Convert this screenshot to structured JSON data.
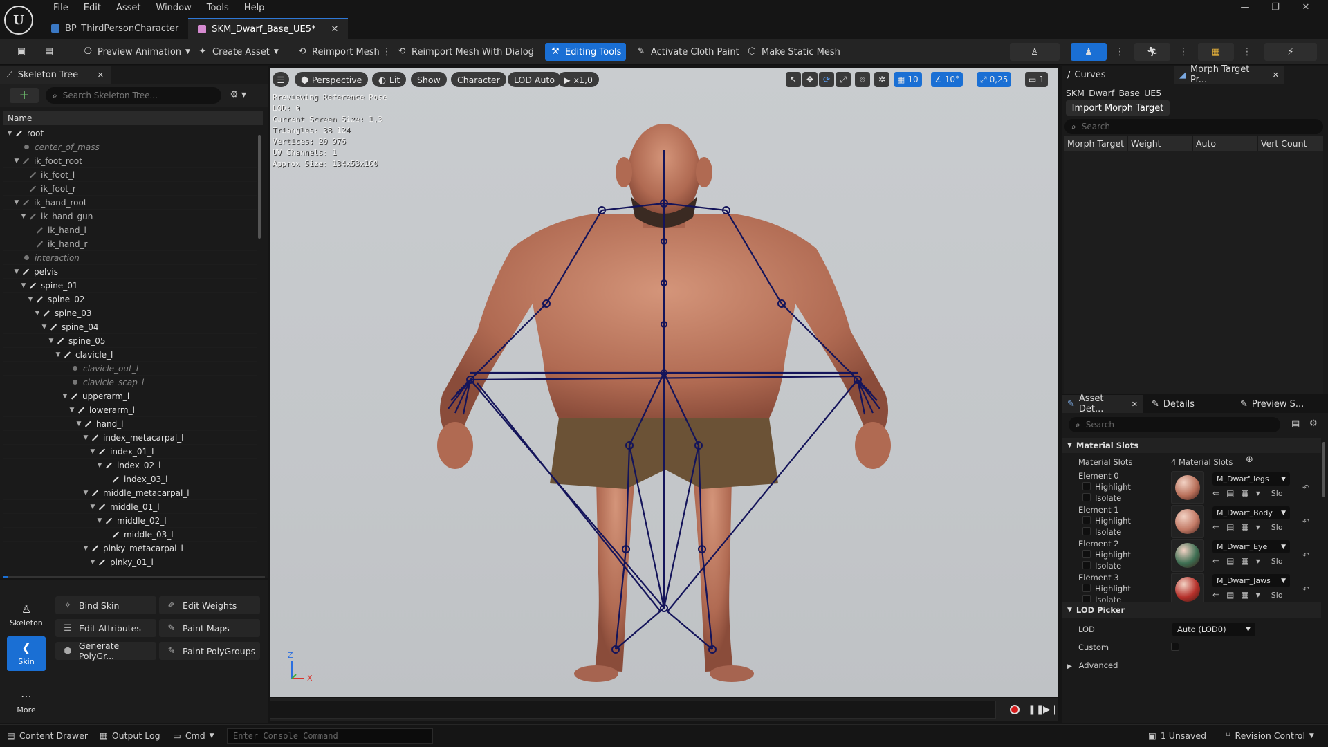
{
  "menu": [
    "File",
    "Edit",
    "Asset",
    "Window",
    "Tools",
    "Help"
  ],
  "tabs": [
    {
      "label": "BP_ThirdPersonCharacter",
      "active": false
    },
    {
      "label": "SKM_Dwarf_Base_UE5*",
      "active": true
    }
  ],
  "toolbar": {
    "preview_animation": "Preview Animation",
    "create_asset": "Create Asset",
    "reimport_mesh": "Reimport Mesh",
    "reimport_dialog": "Reimport Mesh With Dialog",
    "editing_tools": "Editing Tools",
    "cloth_paint": "Activate Cloth Paint",
    "static_mesh": "Make Static Mesh"
  },
  "skeleton": {
    "tab_label": "Skeleton Tree",
    "search_placeholder": "Search Skeleton Tree...",
    "column": "Name",
    "bones": [
      {
        "name": "root",
        "depth": 0,
        "virtual": false,
        "expand": true
      },
      {
        "name": "center_of_mass",
        "depth": 1,
        "virtual": true,
        "expand": false
      },
      {
        "name": "ik_foot_root",
        "depth": 1,
        "virtual": false,
        "expand": true,
        "dim": true
      },
      {
        "name": "ik_foot_l",
        "depth": 2,
        "virtual": false,
        "expand": false,
        "dim": true
      },
      {
        "name": "ik_foot_r",
        "depth": 2,
        "virtual": false,
        "expand": false,
        "dim": true
      },
      {
        "name": "ik_hand_root",
        "depth": 1,
        "virtual": false,
        "expand": true,
        "dim": true
      },
      {
        "name": "ik_hand_gun",
        "depth": 2,
        "virtual": false,
        "expand": true,
        "dim": true
      },
      {
        "name": "ik_hand_l",
        "depth": 3,
        "virtual": false,
        "expand": false,
        "dim": true
      },
      {
        "name": "ik_hand_r",
        "depth": 3,
        "virtual": false,
        "expand": false,
        "dim": true
      },
      {
        "name": "interaction",
        "depth": 1,
        "virtual": true,
        "expand": false
      },
      {
        "name": "pelvis",
        "depth": 1,
        "virtual": false,
        "expand": true
      },
      {
        "name": "spine_01",
        "depth": 2,
        "virtual": false,
        "expand": true
      },
      {
        "name": "spine_02",
        "depth": 3,
        "virtual": false,
        "expand": true
      },
      {
        "name": "spine_03",
        "depth": 4,
        "virtual": false,
        "expand": true
      },
      {
        "name": "spine_04",
        "depth": 5,
        "virtual": false,
        "expand": true
      },
      {
        "name": "spine_05",
        "depth": 6,
        "virtual": false,
        "expand": true
      },
      {
        "name": "clavicle_l",
        "depth": 7,
        "virtual": false,
        "expand": true
      },
      {
        "name": "clavicle_out_l",
        "depth": 8,
        "virtual": true,
        "expand": false
      },
      {
        "name": "clavicle_scap_l",
        "depth": 8,
        "virtual": true,
        "expand": false
      },
      {
        "name": "upperarm_l",
        "depth": 8,
        "virtual": false,
        "expand": true
      },
      {
        "name": "lowerarm_l",
        "depth": 9,
        "virtual": false,
        "expand": true
      },
      {
        "name": "hand_l",
        "depth": 10,
        "virtual": false,
        "expand": true
      },
      {
        "name": "index_metacarpal_l",
        "depth": 11,
        "virtual": false,
        "expand": true
      },
      {
        "name": "index_01_l",
        "depth": 12,
        "virtual": false,
        "expand": true
      },
      {
        "name": "index_02_l",
        "depth": 13,
        "virtual": false,
        "expand": true
      },
      {
        "name": "index_03_l",
        "depth": 14,
        "virtual": false,
        "expand": false
      },
      {
        "name": "middle_metacarpal_l",
        "depth": 11,
        "virtual": false,
        "expand": true
      },
      {
        "name": "middle_01_l",
        "depth": 12,
        "virtual": false,
        "expand": true
      },
      {
        "name": "middle_02_l",
        "depth": 13,
        "virtual": false,
        "expand": true
      },
      {
        "name": "middle_03_l",
        "depth": 14,
        "virtual": false,
        "expand": false
      },
      {
        "name": "pinky_metacarpal_l",
        "depth": 11,
        "virtual": false,
        "expand": true
      },
      {
        "name": "pinky_01_l",
        "depth": 12,
        "virtual": false,
        "expand": true
      }
    ]
  },
  "modes": {
    "skeleton": "Skeleton",
    "skin": "Skin",
    "more": "More"
  },
  "tools": {
    "bind_skin": "Bind Skin",
    "edit_weights": "Edit Weights",
    "edit_attributes": "Edit Attributes",
    "paint_maps": "Paint Maps",
    "generate_polygroups": "Generate PolyGr...",
    "paint_polygroups": "Paint PolyGroups"
  },
  "viewport": {
    "perspective": "Perspective",
    "lit": "Lit",
    "show": "Show",
    "character": "Character",
    "lod": "LOD Auto",
    "speed": "x1,0",
    "grid": "10",
    "angle": "10°",
    "scale": "0,25",
    "cam": "1",
    "stats": [
      "Previewing Reference Pose",
      "LOD: 0",
      "Current Screen Size: 1,3",
      "Triangles: 38 124",
      "Vertices: 20 976",
      "UV Channels: 1",
      "Approx Size: 134x53x160"
    ],
    "axis_x": "X",
    "axis_z": "Z"
  },
  "curves_tab": "Curves",
  "morph": {
    "tab": "Morph Target Pr...",
    "asset": "SKM_Dwarf_Base_UE5",
    "import": "Import Morph Target",
    "search": "Search",
    "cols": [
      "Morph Target N",
      "Weight",
      "Auto",
      "Vert Count"
    ]
  },
  "details": {
    "tabs": [
      "Asset Det...",
      "Details",
      "Preview S..."
    ],
    "search": "Search",
    "material_section": "Material Slots",
    "material_label": "Material Slots",
    "material_count": "4 Material Slots",
    "highlight": "Highlight",
    "isolate": "Isolate",
    "slot_suffix": "Slo",
    "elements": [
      {
        "name": "Element 0",
        "material": "M_Dwarf_legs",
        "color": "#b8705a"
      },
      {
        "name": "Element 1",
        "material": "M_Dwarf_Body",
        "color": "#c27a66"
      },
      {
        "name": "Element 2",
        "material": "M_Dwarf_Eye",
        "color": "#3d6e52"
      },
      {
        "name": "Element 3",
        "material": "M_Dwarf_Jaws",
        "color": "#b5302a"
      }
    ],
    "lod_section": "LOD Picker",
    "lod_label": "LOD",
    "lod_value": "Auto (LOD0)",
    "custom_label": "Custom",
    "advanced": "Advanced"
  },
  "status": {
    "content_drawer": "Content Drawer",
    "output_log": "Output Log",
    "cmd": "Cmd",
    "console_placeholder": "Enter Console Command",
    "unsaved": "1 Unsaved",
    "revision": "Revision Control"
  },
  "colors": {
    "accent": "#1a6fd4",
    "record": "#d61a1a",
    "skeleton_line": "#14145a"
  }
}
